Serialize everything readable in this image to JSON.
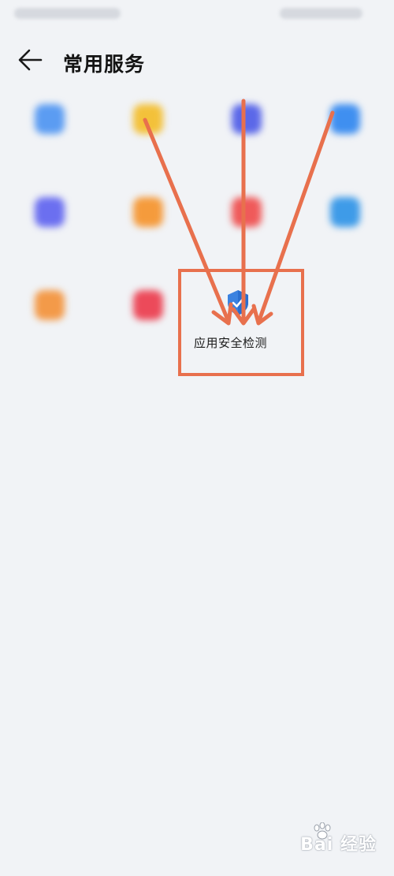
{
  "status_bar": {
    "left_text": "",
    "right_text": ""
  },
  "header": {
    "title": "常用服务",
    "back_icon": "arrow-left-icon"
  },
  "grid": {
    "tiles": [
      {
        "label": "",
        "icon": "gear-icon",
        "color": "#5b9cf2"
      },
      {
        "label": "",
        "icon": "hand-icon",
        "color": "#f3c13a"
      },
      {
        "label": "",
        "icon": "folder-icon",
        "color": "#5b68e8"
      },
      {
        "label": "",
        "icon": "bulb-icon",
        "color": "#3f8ff0"
      },
      {
        "label": "",
        "icon": "calendar-icon",
        "color": "#6b6ff0"
      },
      {
        "label": "",
        "icon": "bag-icon",
        "color": "#f59b3c"
      },
      {
        "label": "",
        "icon": "heart-icon",
        "color": "#ef5a5a"
      },
      {
        "label": "",
        "icon": "doc-icon",
        "color": "#3e9be8"
      },
      {
        "label": "",
        "icon": "person-icon",
        "color": "#f39a49"
      },
      {
        "label": "",
        "icon": "heart-icon",
        "color": "#ec4a5a"
      }
    ],
    "focus_tile": {
      "label": "应用安全检测",
      "icon": "shield-icon",
      "color": "#3b82e0"
    }
  },
  "annotation": {
    "color": "#e8704d"
  },
  "watermark": {
    "text": "Bai 经验",
    "icon": "paw-icon"
  }
}
